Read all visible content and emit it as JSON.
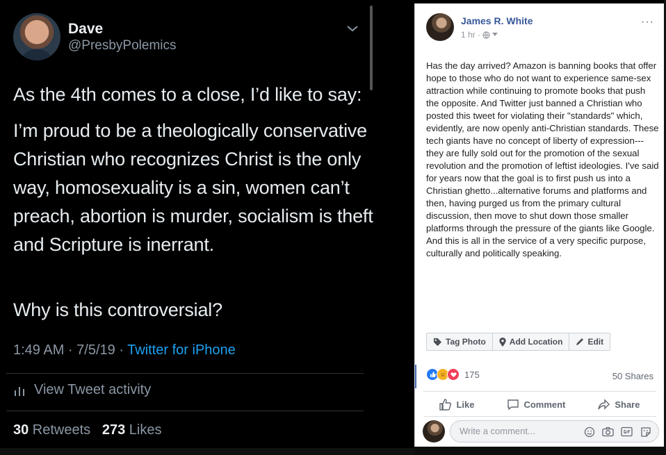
{
  "tweet": {
    "display_name": "Dave",
    "handle": "@PresbyPolemics",
    "paragraphs": [
      "As the 4th comes to a close, I’d like to say:",
      "I’m proud to be a theologically conservative Christian who recognizes Christ is the only way, homosexuality is a sin, women can’t preach, abortion is murder, socialism is theft and Scripture is inerrant.",
      "Why is this controversial?"
    ],
    "time": "1:49 AM · 7/5/19 · ",
    "client": "Twitter for iPhone",
    "activity_label": "View Tweet activity",
    "retweets_count": "30",
    "retweets_label": " Retweets",
    "likes_count": "273",
    "likes_label": " Likes"
  },
  "facebook_post": {
    "author": "James R. White",
    "time": "1 hr ·",
    "more": "···",
    "body": "Has the day arrived? Amazon is banning books that offer hope to those who do not want to experience same-sex attraction while continuing to promote books that push the opposite. And Twitter just banned a Christian who posted this tweet for violating their \"standards\" which, evidently, are now openly anti-Christian standards. These tech giants have no concept of liberty of expression---they are fully sold out for the promotion of the sexual revolution and the promotion of leftist ideologies. I've said for years now that the goal is to first push us into a Christian ghetto...alternative forums and platforms and then, having purged us from the primary cultural discussion, then move to shut down those smaller platforms through the pressure of the giants like Google. And this is all in the service of a very specific purpose, culturally and politically speaking.",
    "tag_actions": [
      "Tag Photo",
      "Add Location",
      "Edit"
    ],
    "reactions_count": "175",
    "shares": "50 Shares",
    "actions": [
      "Like",
      "Comment",
      "Share"
    ],
    "comment_placeholder": "Write a comment..."
  },
  "colors": {
    "twitter_link": "#1da1f2",
    "fb_name": "#385898",
    "fb_like": "#2078f4",
    "fb_love": "#f33e58",
    "fb_sad": "#f7b125"
  }
}
